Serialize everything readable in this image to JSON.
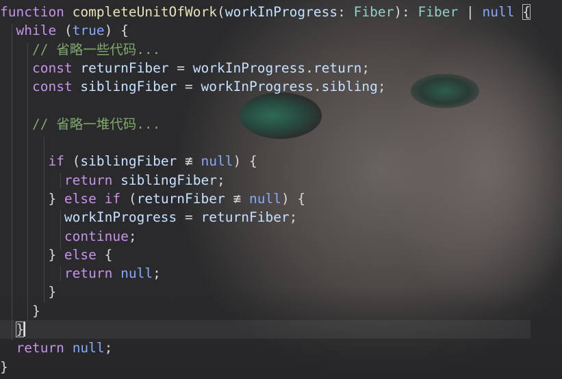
{
  "editor": {
    "lines": [
      [
        [
          "kw",
          "function"
        ],
        [
          "pu",
          " "
        ],
        [
          "fn",
          "completeUnitOfWork"
        ],
        [
          "pu",
          "("
        ],
        [
          "id",
          "workInProgress"
        ],
        [
          "pu",
          ": "
        ],
        [
          "ty",
          "Fiber"
        ],
        [
          "pu",
          "): "
        ],
        [
          "ty",
          "Fiber"
        ],
        [
          "pu",
          " | "
        ],
        [
          "lit",
          "null"
        ],
        [
          "pu",
          " "
        ],
        [
          "brace",
          "{"
        ]
      ],
      [
        [
          "pu",
          "  "
        ],
        [
          "kw",
          "while"
        ],
        [
          "pu",
          " ("
        ],
        [
          "lit",
          "true"
        ],
        [
          "pu",
          ") {"
        ]
      ],
      [
        [
          "pu",
          "    "
        ],
        [
          "cm",
          "// 省略一些代码..."
        ]
      ],
      [
        [
          "pu",
          "    "
        ],
        [
          "kw",
          "const"
        ],
        [
          "pu",
          " "
        ],
        [
          "id",
          "returnFiber"
        ],
        [
          "pu",
          " = "
        ],
        [
          "id",
          "workInProgress"
        ],
        [
          "pu",
          "."
        ],
        [
          "id",
          "return"
        ],
        [
          "pu",
          ";"
        ]
      ],
      [
        [
          "pu",
          "    "
        ],
        [
          "kw",
          "const"
        ],
        [
          "pu",
          " "
        ],
        [
          "id",
          "siblingFiber"
        ],
        [
          "pu",
          " = "
        ],
        [
          "id",
          "workInProgress"
        ],
        [
          "pu",
          "."
        ],
        [
          "id",
          "sibling"
        ],
        [
          "pu",
          ";"
        ]
      ],
      [],
      [
        [
          "pu",
          "    "
        ],
        [
          "cm",
          "// 省略一堆代码..."
        ]
      ],
      [],
      [
        [
          "pu",
          "      "
        ],
        [
          "kw",
          "if"
        ],
        [
          "pu",
          " ("
        ],
        [
          "id",
          "siblingFiber"
        ],
        [
          "pu",
          " ≢ "
        ],
        [
          "lit",
          "null"
        ],
        [
          "pu",
          ") {"
        ]
      ],
      [
        [
          "pu",
          "        "
        ],
        [
          "kw",
          "return"
        ],
        [
          "pu",
          " "
        ],
        [
          "id",
          "siblingFiber"
        ],
        [
          "pu",
          ";"
        ]
      ],
      [
        [
          "pu",
          "      } "
        ],
        [
          "kw",
          "else"
        ],
        [
          "pu",
          " "
        ],
        [
          "kw",
          "if"
        ],
        [
          "pu",
          " ("
        ],
        [
          "id",
          "returnFiber"
        ],
        [
          "pu",
          " ≢ "
        ],
        [
          "lit",
          "null"
        ],
        [
          "pu",
          ") {"
        ]
      ],
      [
        [
          "pu",
          "        "
        ],
        [
          "id",
          "workInProgress"
        ],
        [
          "pu",
          " = "
        ],
        [
          "id",
          "returnFiber"
        ],
        [
          "pu",
          ";"
        ]
      ],
      [
        [
          "pu",
          "        "
        ],
        [
          "kw",
          "continue"
        ],
        [
          "pu",
          ";"
        ]
      ],
      [
        [
          "pu",
          "      } "
        ],
        [
          "kw",
          "else"
        ],
        [
          "pu",
          " {"
        ]
      ],
      [
        [
          "pu",
          "        "
        ],
        [
          "kw",
          "return"
        ],
        [
          "pu",
          " "
        ],
        [
          "lit",
          "null"
        ],
        [
          "pu",
          ";"
        ]
      ],
      [
        [
          "pu",
          "      }"
        ]
      ],
      [
        [
          "pu",
          "    }"
        ]
      ],
      [
        [
          "pu",
          "  "
        ],
        [
          "brace",
          "}"
        ],
        [
          "cursor",
          ""
        ]
      ],
      [
        [
          "pu",
          "  "
        ],
        [
          "kw",
          "return"
        ],
        [
          "pu",
          " "
        ],
        [
          "lit",
          "null"
        ],
        [
          "pu",
          ";"
        ]
      ],
      [
        [
          "pu",
          "}"
        ]
      ]
    ],
    "active_line": 17,
    "colors": {
      "keyword": "#c792ea",
      "function_name": "#e8e2b8",
      "type": "#8fd1c7",
      "literal": "#82aaff",
      "identifier": "#c5e1ff",
      "comment": "#7fa86c"
    }
  }
}
